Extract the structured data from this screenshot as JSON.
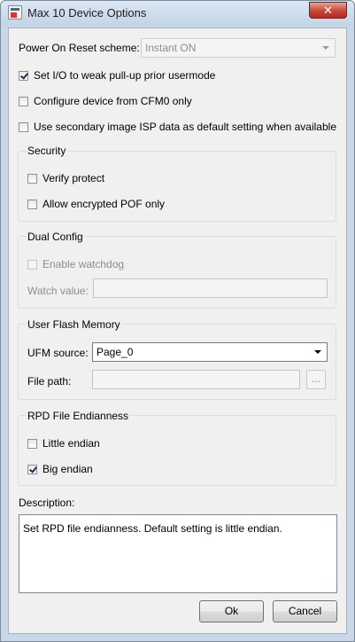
{
  "window": {
    "title": "Max 10 Device Options",
    "close_label": "✕"
  },
  "power_on_reset": {
    "label": "Power On Reset scheme:",
    "value": "Instant ON"
  },
  "options": [
    {
      "label": "Set I/O to weak pull-up prior usermode",
      "checked": true
    },
    {
      "label": "Configure device from CFM0 only",
      "checked": false
    },
    {
      "label": "Use secondary image ISP data as default setting when available",
      "checked": false
    }
  ],
  "security": {
    "title": "Security",
    "items": [
      {
        "label": "Verify protect",
        "checked": false
      },
      {
        "label": "Allow encrypted POF only",
        "checked": false
      }
    ]
  },
  "dual_config": {
    "title": "Dual Config",
    "watchdog_label": "Enable watchdog",
    "watch_value_label": "Watch value:",
    "watch_value": ""
  },
  "ufm": {
    "title": "User Flash Memory",
    "source_label": "UFM source:",
    "source_value": "Page_0",
    "file_path_label": "File path:",
    "file_path_value": "",
    "browse_label": "..."
  },
  "rpd": {
    "title": "RPD File Endianness",
    "items": [
      {
        "label": "Little endian",
        "checked": false
      },
      {
        "label": "Big endian",
        "checked": true
      }
    ]
  },
  "description": {
    "label": "Description:",
    "text": "Set RPD file endianness. Default setting is little endian."
  },
  "buttons": {
    "ok": "Ok",
    "cancel": "Cancel"
  }
}
